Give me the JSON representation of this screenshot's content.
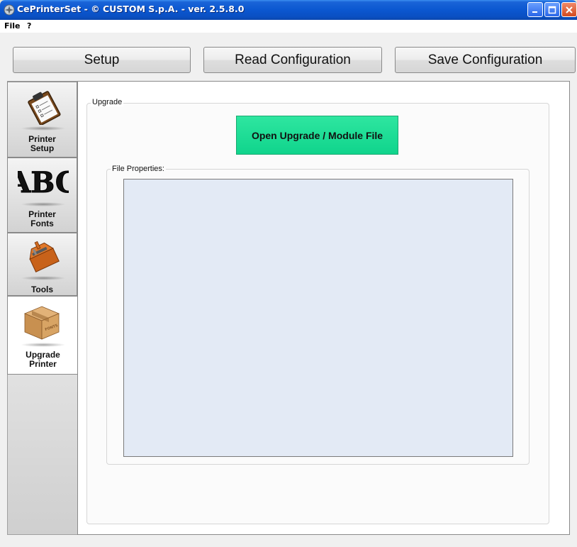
{
  "window": {
    "title": "CePrinterSet - © CUSTOM S.p.A. - ver. 2.5.8.0"
  },
  "menu": {
    "file": "File",
    "help": "?"
  },
  "toolbar": {
    "setup": "Setup",
    "read": "Read Configuration",
    "save": "Save Configuration"
  },
  "tabs": [
    {
      "label_line1": "Printer",
      "label_line2": "Setup",
      "icon": "clipboard-icon"
    },
    {
      "label_line1": "Printer",
      "label_line2": "Fonts",
      "icon": "abc-font-icon"
    },
    {
      "label_line1": "Tools",
      "label_line2": "",
      "icon": "toolbox-icon"
    },
    {
      "label_line1": "Upgrade",
      "label_line2": "Printer",
      "icon": "package-box-icon"
    }
  ],
  "upgrade": {
    "group_title": "Upgrade",
    "open_button": "Open Upgrade / Module File",
    "file_properties_title": "File Properties:",
    "box_stamp": "FONTS"
  },
  "colors": {
    "open_button": "#10d48c",
    "file_box": "#e3eaf5"
  }
}
